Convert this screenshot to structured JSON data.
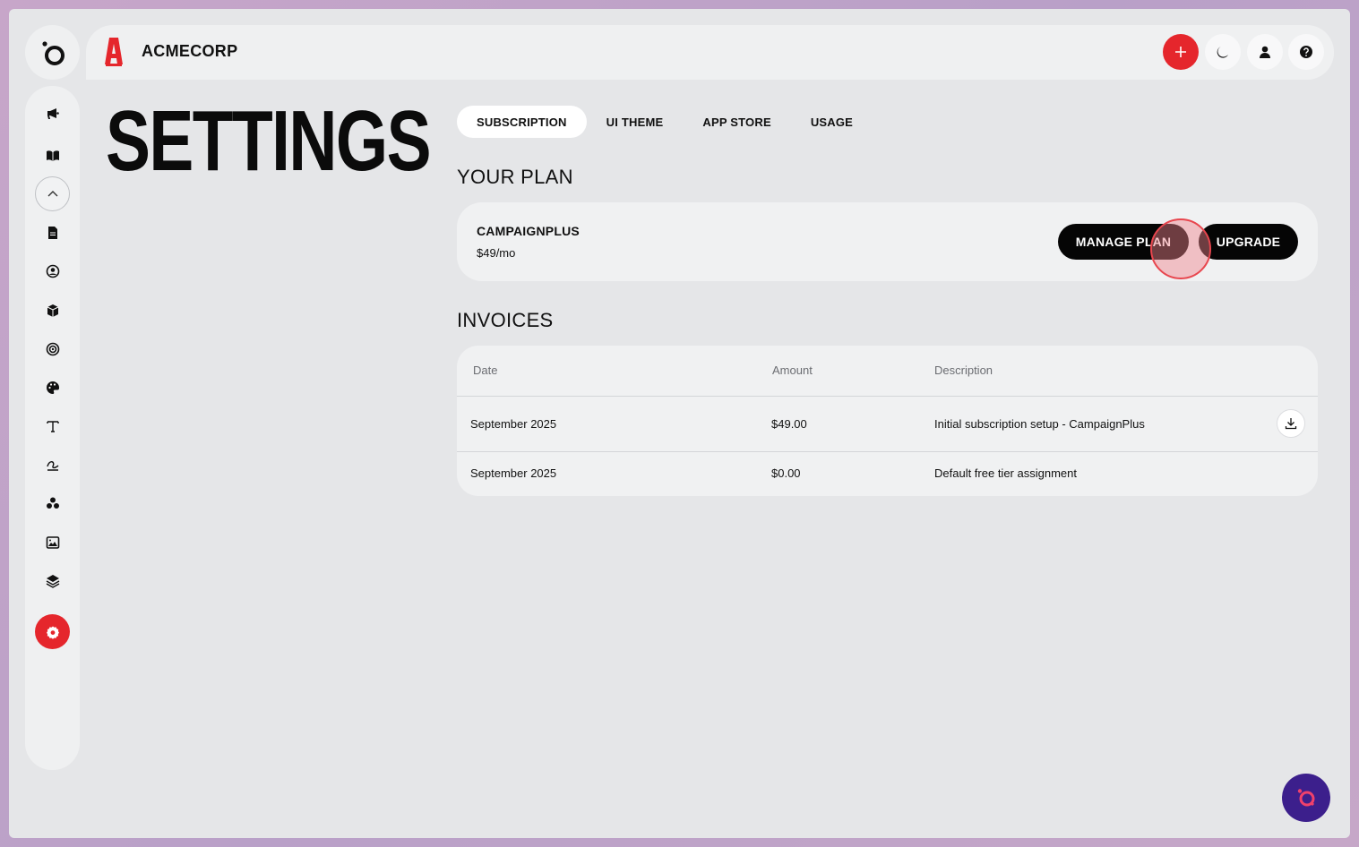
{
  "header": {
    "brand_name": "ACMECORP",
    "actions": [
      {
        "name": "add-button",
        "icon": "plus-icon"
      },
      {
        "name": "dark-mode-button",
        "icon": "moon-icon"
      },
      {
        "name": "profile-button",
        "icon": "user-icon"
      },
      {
        "name": "help-button",
        "icon": "question-icon"
      }
    ]
  },
  "sidebar": {
    "items": [
      {
        "name": "campaigns",
        "icon": "megaphone-icon"
      },
      {
        "name": "library",
        "icon": "book-icon"
      },
      {
        "name": "collapse",
        "icon": "chevron-up-icon"
      },
      {
        "name": "documents",
        "icon": "document-icon"
      },
      {
        "name": "contacts",
        "icon": "user-circle-icon"
      },
      {
        "name": "products",
        "icon": "cube-icon"
      },
      {
        "name": "targets",
        "icon": "target-icon"
      },
      {
        "name": "palette",
        "icon": "palette-icon"
      },
      {
        "name": "typography",
        "icon": "text-icon"
      },
      {
        "name": "signature",
        "icon": "signature-icon"
      },
      {
        "name": "groups",
        "icon": "circles-icon"
      },
      {
        "name": "images",
        "icon": "image-icon"
      },
      {
        "name": "layers",
        "icon": "layers-icon"
      },
      {
        "name": "settings",
        "icon": "gear-icon"
      }
    ]
  },
  "page": {
    "title": "SETTINGS",
    "tabs": [
      {
        "label": "SUBSCRIPTION",
        "active": true
      },
      {
        "label": "UI THEME",
        "active": false
      },
      {
        "label": "APP STORE",
        "active": false
      },
      {
        "label": "USAGE",
        "active": false
      }
    ]
  },
  "plan": {
    "section_title": "YOUR PLAN",
    "name": "CAMPAIGNPLUS",
    "price": "$49/mo",
    "manage_label": "MANAGE PLAN",
    "upgrade_label": "UPGRADE"
  },
  "invoices": {
    "section_title": "INVOICES",
    "columns": [
      "Date",
      "Amount",
      "Description"
    ],
    "rows": [
      {
        "date": "September 2025",
        "amount": "$49.00",
        "description": "Initial subscription setup - CampaignPlus",
        "downloadable": true
      },
      {
        "date": "September 2025",
        "amount": "$0.00",
        "description": "Default free tier assignment",
        "downloadable": false
      }
    ]
  },
  "colors": {
    "accent_red": "#e5262c",
    "fab_purple": "#3c1f8c",
    "button_black": "#050505"
  }
}
